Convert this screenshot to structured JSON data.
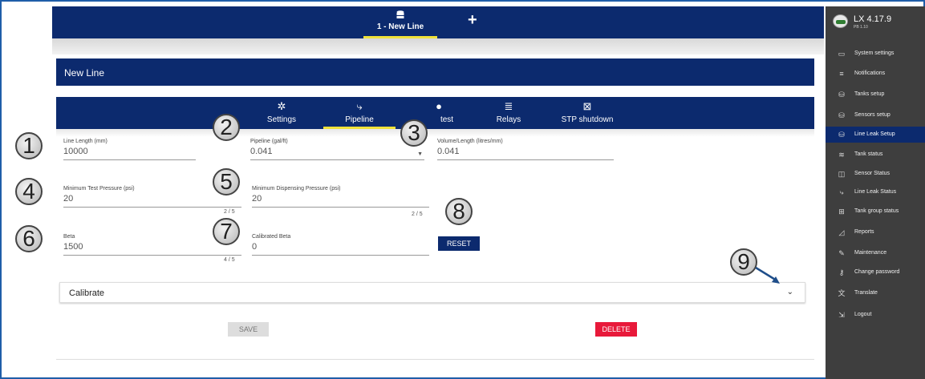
{
  "top_tabs": {
    "line_tab_label": "1 - New Line",
    "add_icon": "plus-icon"
  },
  "title": "New Line",
  "sub_tabs": [
    {
      "label": "Settings",
      "icon": "gear-icon"
    },
    {
      "label": "Pipeline",
      "icon": "pipeline-icon"
    },
    {
      "label": "test",
      "icon": "drop-icon"
    },
    {
      "label": "Relays",
      "icon": "relay-icon"
    },
    {
      "label": "STP shutdown",
      "icon": "stp-shutdown-icon"
    }
  ],
  "fields": {
    "line_length": {
      "label": "Line Length (mm)",
      "value": "10000"
    },
    "pipeline": {
      "label": "Pipeline (gal/ft)",
      "value": "0.041"
    },
    "volume_length": {
      "label": "Volume/Length (litres/mm)",
      "value": "0.041"
    },
    "min_test_pressure": {
      "label": "Minimum Test Pressure (psi)",
      "value": "20",
      "counter": "2 / 5"
    },
    "min_dispensing_pressure": {
      "label": "Minimum Dispensing Pressure (psi)",
      "value": "20",
      "counter": "2 / 5"
    },
    "beta": {
      "label": "Beta",
      "value": "1500",
      "counter": "4 / 5"
    },
    "calibrated_beta": {
      "label": "Calibrated Beta",
      "value": "0"
    }
  },
  "buttons": {
    "reset": "RESET",
    "save": "SAVE",
    "delete": "DELETE"
  },
  "calibrate": {
    "label": "Calibrate"
  },
  "callouts": [
    "1",
    "2",
    "3",
    "4",
    "5",
    "6",
    "7",
    "8",
    "9"
  ],
  "sidebar": {
    "version": "LX 4.17.9",
    "build": "PB 1.10",
    "items": [
      {
        "label": "System settings",
        "icon": "monitor-icon"
      },
      {
        "label": "Notifications",
        "icon": "notifications-icon"
      },
      {
        "label": "Tanks setup",
        "icon": "database-icon"
      },
      {
        "label": "Sensors setup",
        "icon": "database-icon"
      },
      {
        "label": "Line Leak Setup",
        "icon": "database-icon",
        "active": true
      },
      {
        "label": "Tank status",
        "icon": "waves-icon"
      },
      {
        "label": "Sensor Status",
        "icon": "sensor-icon"
      },
      {
        "label": "Line Leak Status",
        "icon": "pipeline-icon"
      },
      {
        "label": "Tank group status",
        "icon": "tank-group-icon"
      },
      {
        "label": "Reports",
        "icon": "chart-icon"
      },
      {
        "label": "Maintenance",
        "icon": "wrench-icon"
      },
      {
        "label": "Change password",
        "icon": "key-icon"
      },
      {
        "label": "Translate",
        "icon": "translate-icon"
      },
      {
        "label": "Logout",
        "icon": "logout-icon"
      }
    ]
  },
  "colors": {
    "navy": "#0c2a6e",
    "sidebar": "#3e3e3e",
    "accent": "#f0e23a",
    "delete": "#e8193a",
    "frame": "#1f5da8"
  }
}
